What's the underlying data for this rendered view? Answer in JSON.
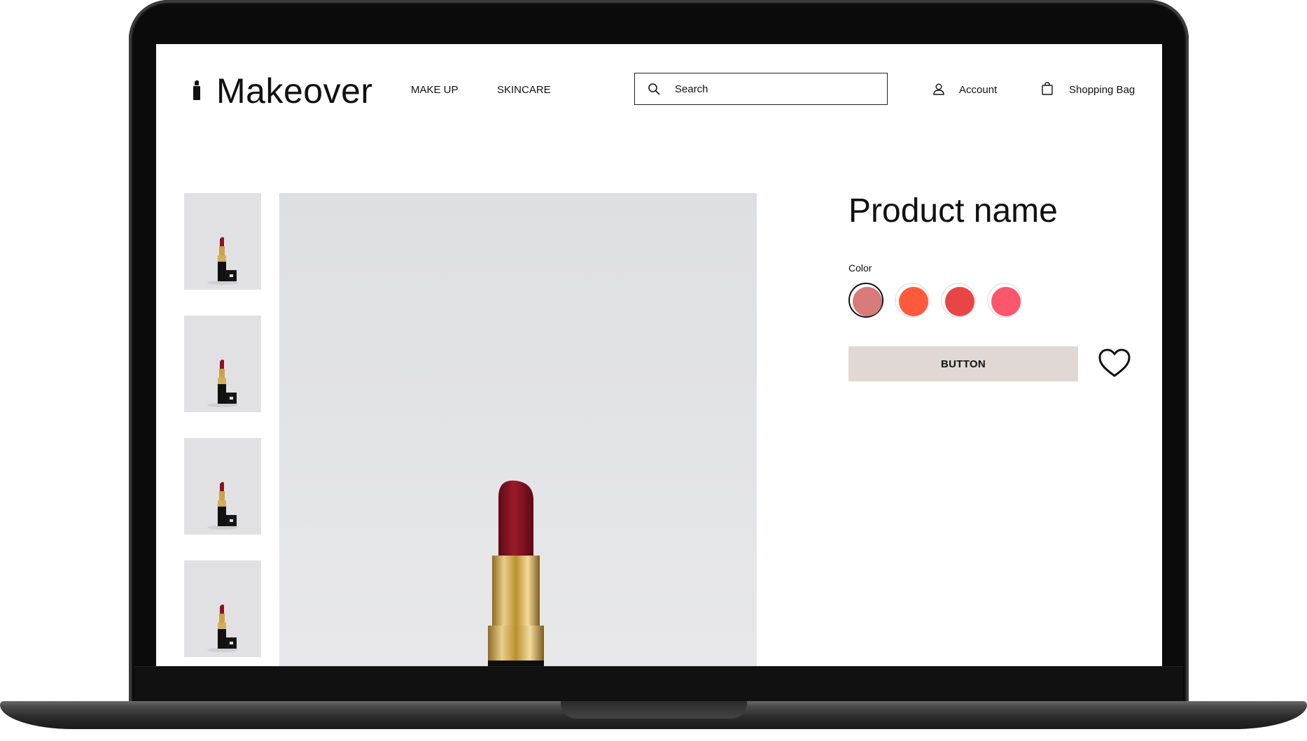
{
  "brand": {
    "name": "Makeover",
    "logo_icon": "lipstick-icon"
  },
  "nav": {
    "items": [
      {
        "label": "MAKE UP"
      },
      {
        "label": "SKINCARE"
      }
    ]
  },
  "search": {
    "placeholder": "Search",
    "icon": "search-icon"
  },
  "header_links": {
    "account": "Account",
    "bag": "Shopping Bag"
  },
  "product": {
    "name": "Product name",
    "color_label": "Color",
    "swatches": [
      {
        "color": "#d67a7a",
        "selected": true
      },
      {
        "color": "#ff5a3c",
        "selected": false
      },
      {
        "color": "#e84646",
        "selected": false
      },
      {
        "color": "#fc566c",
        "selected": false
      }
    ],
    "button_label": "BUTTON",
    "wishlist_icon": "heart-icon"
  },
  "gallery": {
    "thumbnail_count": 4,
    "subject": "lipstick"
  },
  "colors": {
    "button_bg": "#e0d8d4",
    "text": "#111111",
    "photo_bg": "#e1e2e5"
  }
}
